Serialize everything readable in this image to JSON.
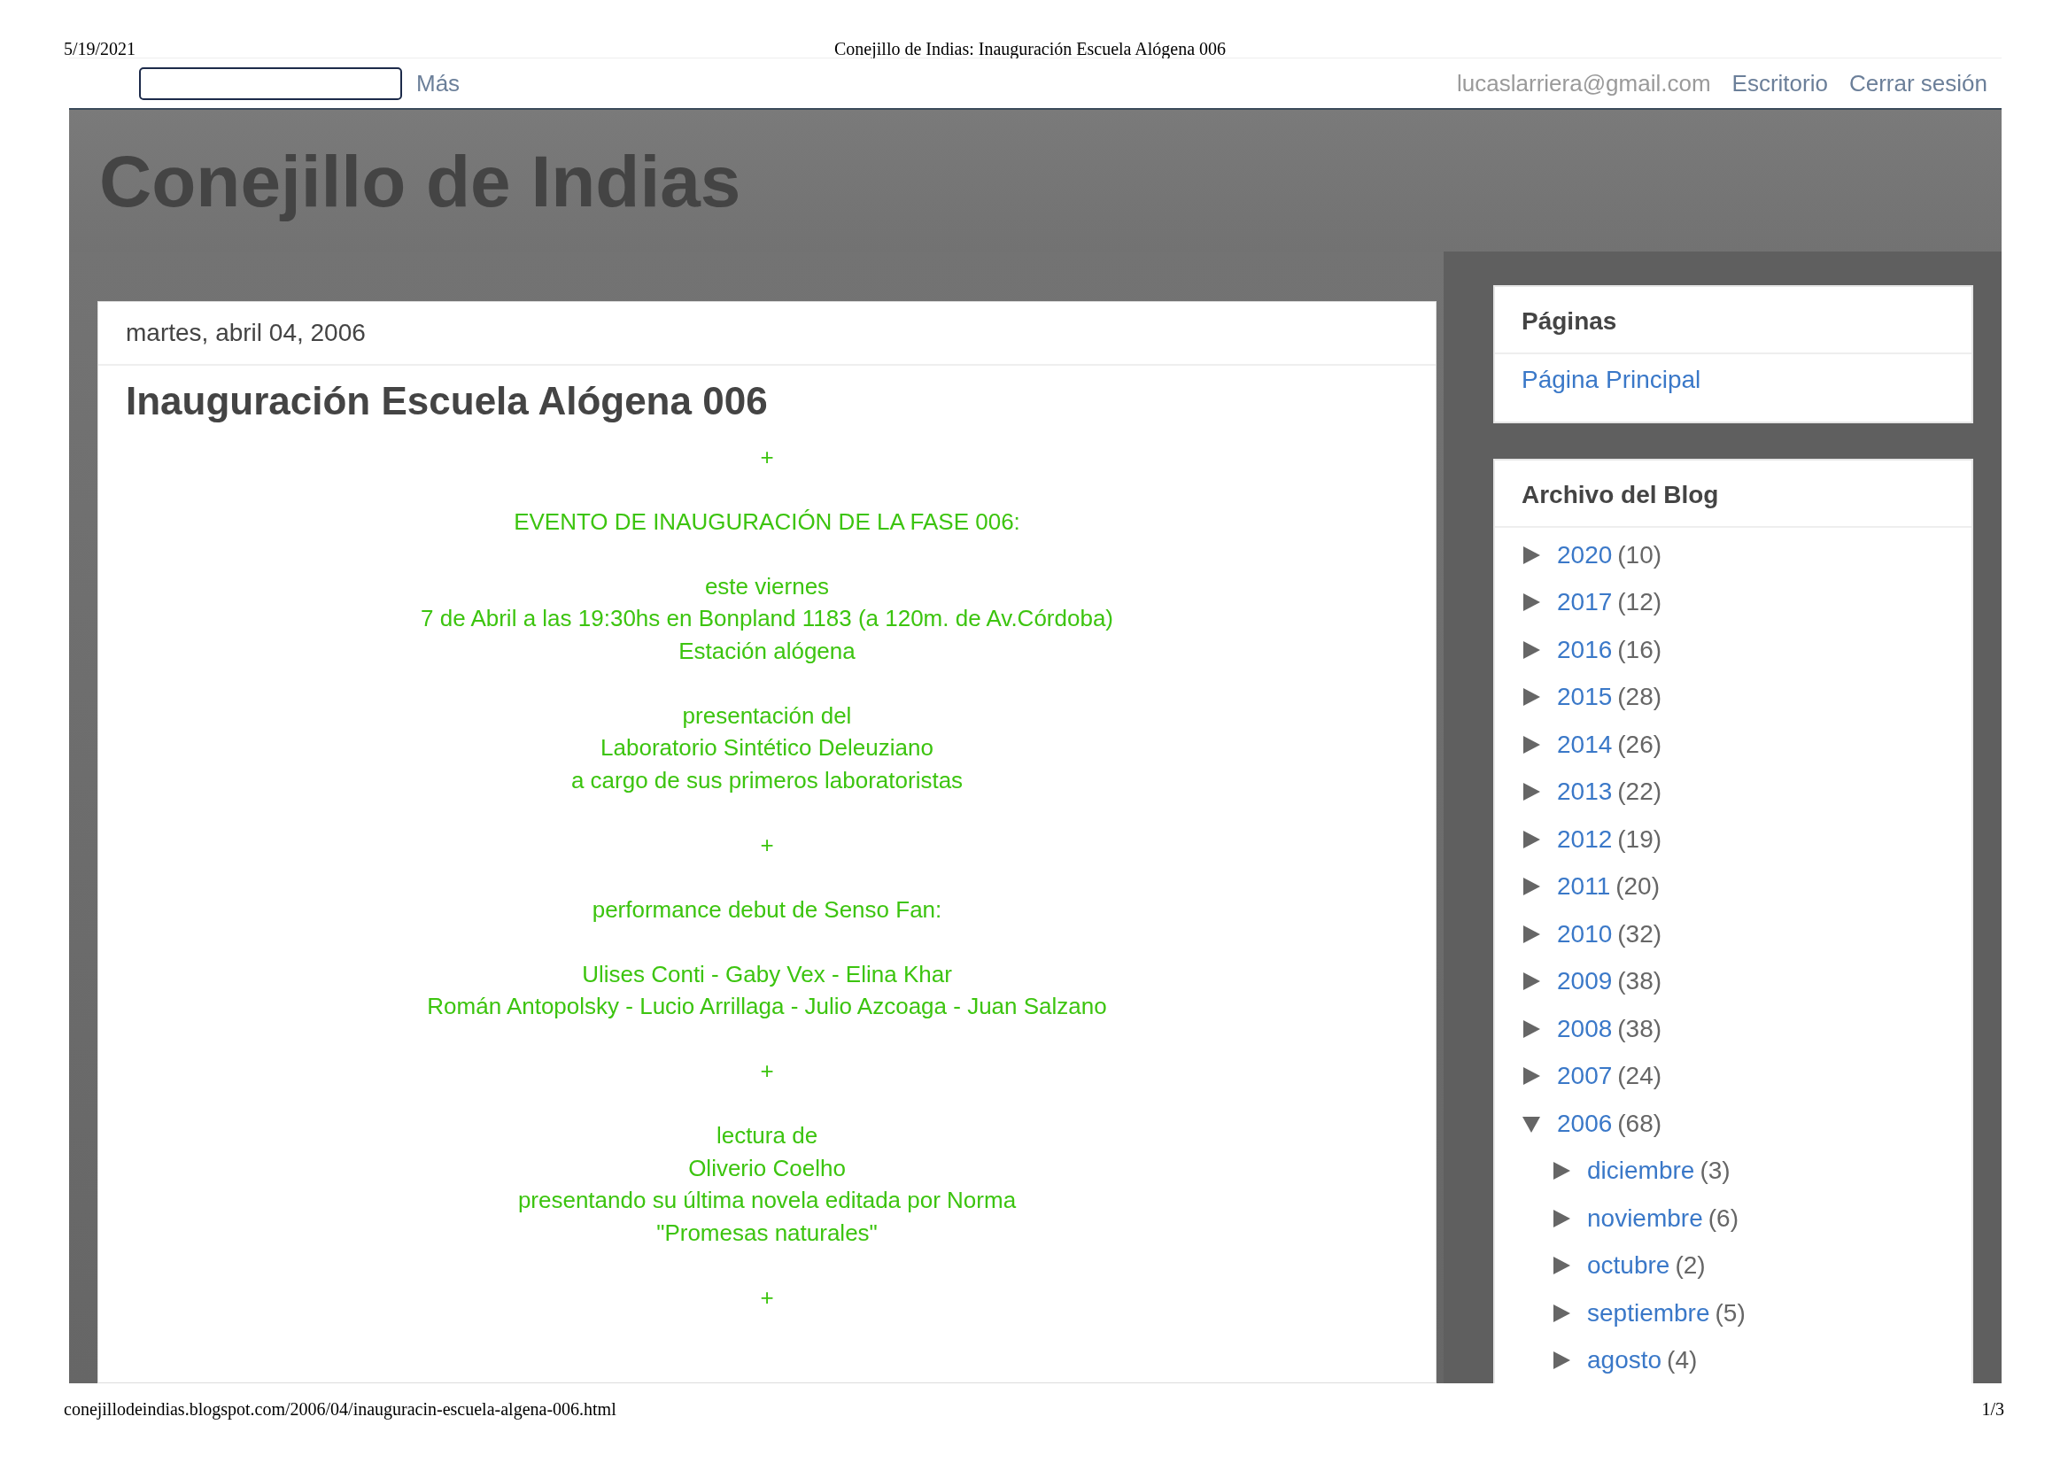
{
  "print_header": {
    "date": "5/19/2021",
    "title": "Conejillo de Indias: Inauguración Escuela Alógena 006"
  },
  "navbar": {
    "more": "Más",
    "email": "lucaslarriera@gmail.com",
    "links": [
      "Escritorio",
      "Cerrar sesión"
    ]
  },
  "blog_title": "Conejillo de Indias",
  "post": {
    "date": "martes, abril 04, 2006",
    "title": "Inauguración Escuela Alógena 006",
    "paragraphs": [
      [
        "+"
      ],
      [
        "EVENTO DE INAUGURACIÓN DE LA FASE 006:"
      ],
      [
        "este viernes",
        "7 de Abril a las 19:30hs en Bonpland 1183 (a 120m. de Av.Córdoba)",
        "Estación alógena"
      ],
      [
        "presentación del",
        "Laboratorio Sintético Deleuziano",
        "a cargo de sus primeros laboratoristas"
      ],
      [
        "+"
      ],
      [
        "performance debut de Senso Fan:"
      ],
      [
        "Ulises Conti - Gaby Vex - Elina Khar",
        "Román Antopolsky - Lucio Arrillaga - Julio Azcoaga - Juan Salzano"
      ],
      [
        "+"
      ],
      [
        "lectura de",
        "Oliverio Coelho",
        "presentando su última novela editada por Norma",
        "\"Promesas naturales\""
      ],
      [
        "+"
      ]
    ]
  },
  "sidebar": {
    "pages": {
      "title": "Páginas",
      "links": [
        "Página Principal"
      ]
    },
    "archive": {
      "title": "Archivo del Blog",
      "items": [
        {
          "label": "2020",
          "count": "(10)",
          "expanded": false
        },
        {
          "label": "2017",
          "count": "(12)",
          "expanded": false
        },
        {
          "label": "2016",
          "count": "(16)",
          "expanded": false
        },
        {
          "label": "2015",
          "count": "(28)",
          "expanded": false
        },
        {
          "label": "2014",
          "count": "(26)",
          "expanded": false
        },
        {
          "label": "2013",
          "count": "(22)",
          "expanded": false
        },
        {
          "label": "2012",
          "count": "(19)",
          "expanded": false
        },
        {
          "label": "2011",
          "count": "(20)",
          "expanded": false
        },
        {
          "label": "2010",
          "count": "(32)",
          "expanded": false
        },
        {
          "label": "2009",
          "count": "(38)",
          "expanded": false
        },
        {
          "label": "2008",
          "count": "(38)",
          "expanded": false
        },
        {
          "label": "2007",
          "count": "(24)",
          "expanded": false
        },
        {
          "label": "2006",
          "count": "(68)",
          "expanded": true,
          "children": [
            {
              "label": "diciembre",
              "count": "(3)",
              "expanded": false
            },
            {
              "label": "noviembre",
              "count": "(6)",
              "expanded": false
            },
            {
              "label": "octubre",
              "count": "(2)",
              "expanded": false
            },
            {
              "label": "septiembre",
              "count": "(5)",
              "expanded": false
            },
            {
              "label": "agosto",
              "count": "(4)",
              "expanded": false
            }
          ]
        }
      ]
    }
  },
  "print_footer": {
    "url": "conejillodeindias.blogspot.com/2006/04/inauguracin-escuela-algena-006.html",
    "page": "1/3"
  }
}
